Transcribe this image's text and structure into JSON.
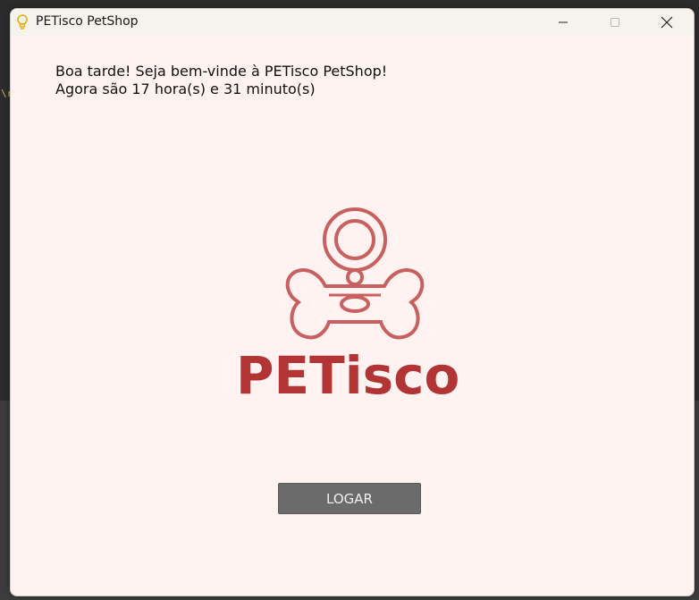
{
  "window": {
    "title": "PETisco PetShop",
    "icon": "lightbulb-icon"
  },
  "greeting": {
    "line1": "Boa tarde! Seja bem-vinde à PETisco PetShop!",
    "line2": "Agora são 17 hora(s) e 31 minuto(s)"
  },
  "brand": {
    "name": "PETisco",
    "color": "#b23434",
    "logo_icon": "bone-with-tag-logo"
  },
  "actions": {
    "login_label": "LOGAR"
  },
  "colors": {
    "window_bg": "#fff2f1",
    "logo_stroke": "#c86060",
    "button_bg": "#6b6b6b"
  }
}
